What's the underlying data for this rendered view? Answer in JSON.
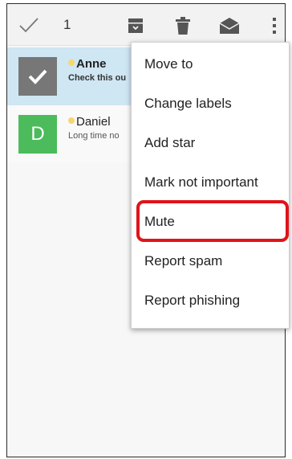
{
  "action_bar": {
    "selected_count": "1",
    "icons": [
      "check-icon",
      "archive-icon",
      "trash-icon",
      "mark-unread-icon",
      "overflow-menu-icon"
    ]
  },
  "conversations": [
    {
      "sender": "Anne",
      "snippet": "Check this ou",
      "avatar_letter": "",
      "selected": true
    },
    {
      "sender": "Daniel",
      "snippet": "Long time no",
      "avatar_letter": "D",
      "selected": false
    }
  ],
  "overflow_menu": {
    "items": [
      "Move to",
      "Change labels",
      "Add star",
      "Mark not important",
      "Mute",
      "Report spam",
      "Report phishing"
    ],
    "highlighted_item": "Mute"
  },
  "colors": {
    "selected_row": "#cfe6f3",
    "avatar_selected": "#777777",
    "avatar_d": "#4cbb5b",
    "highlight_outline": "#e0141a"
  }
}
